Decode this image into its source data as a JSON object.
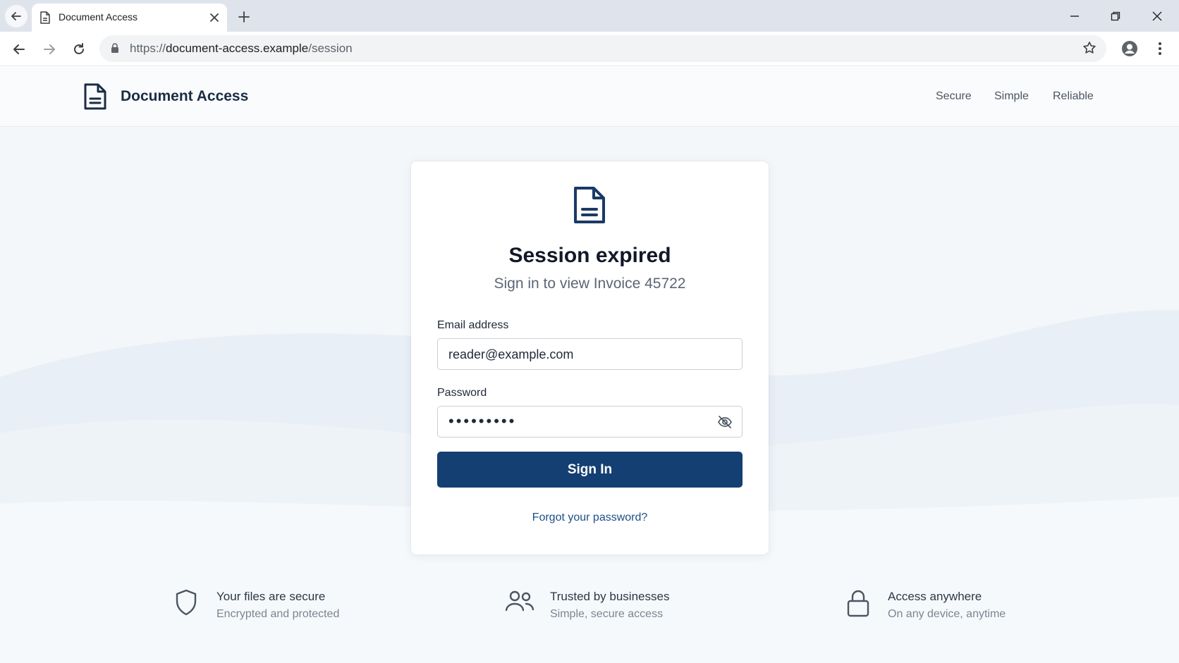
{
  "browser": {
    "tab_title": "Document Access",
    "url_scheme": "https://",
    "url_host": "document-access.example",
    "url_path": "/session"
  },
  "site": {
    "brand": "Document Access",
    "nav": [
      "Secure",
      "Simple",
      "Reliable"
    ]
  },
  "card": {
    "title": "Session expired",
    "subtitle": "Sign in to view Invoice 45722",
    "email_label": "Email address",
    "email_value": "reader@example.com",
    "password_label": "Password",
    "password_mask": "•••••••••",
    "signin_label": "Sign In",
    "forgot_label": "Forgot your password?"
  },
  "features": [
    {
      "title": "Your files are secure",
      "desc": "Encrypted and protected",
      "icon": "shield-icon"
    },
    {
      "title": "Trusted by businesses",
      "desc": "Simple, secure access",
      "icon": "users-icon"
    },
    {
      "title": "Access anywhere",
      "desc": "On any device, anytime",
      "icon": "lock-icon"
    }
  ],
  "colors": {
    "accent": "#143f72",
    "link": "#1d4f86",
    "page_bg": "#f4f7fa"
  }
}
